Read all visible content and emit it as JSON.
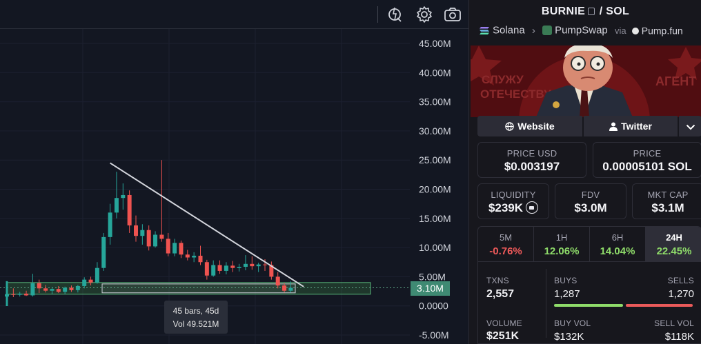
{
  "chart": {
    "y_axis_labels": [
      "45.00M",
      "40.00M",
      "35.00M",
      "30.00M",
      "25.00M",
      "20.00M",
      "15.00M",
      "10.00M",
      "5.00M",
      "0.0000",
      "-5.00M"
    ],
    "current_price_label": "3.10M",
    "range_tooltip": {
      "bars": "45 bars, 45d",
      "volume": "Vol 49.521M"
    },
    "up_color": "#26a69a",
    "down_color": "#ef5350",
    "price_tag_color": "#3f8a73"
  },
  "chart_data": {
    "type": "candlestick",
    "ylim": [
      -5000000,
      45000000
    ],
    "candles": [
      {
        "o": 1.6,
        "h": 2.2,
        "l": 1.2,
        "c": 2.0
      },
      {
        "o": 2.0,
        "h": 3.0,
        "l": 1.5,
        "c": 1.9
      },
      {
        "o": 1.9,
        "h": 2.4,
        "l": 1.6,
        "c": 2.1
      },
      {
        "o": 2.1,
        "h": 2.6,
        "l": 1.7,
        "c": 1.8
      },
      {
        "o": 1.8,
        "h": 5.5,
        "l": 1.6,
        "c": 3.9
      },
      {
        "o": 3.9,
        "h": 4.5,
        "l": 2.2,
        "c": 3.0
      },
      {
        "o": 3.0,
        "h": 3.6,
        "l": 2.3,
        "c": 2.6
      },
      {
        "o": 2.6,
        "h": 3.2,
        "l": 2.0,
        "c": 2.9
      },
      {
        "o": 2.9,
        "h": 3.4,
        "l": 2.2,
        "c": 2.4
      },
      {
        "o": 2.4,
        "h": 3.3,
        "l": 2.0,
        "c": 3.1
      },
      {
        "o": 3.1,
        "h": 3.5,
        "l": 2.4,
        "c": 2.7
      },
      {
        "o": 2.7,
        "h": 3.6,
        "l": 2.3,
        "c": 3.4
      },
      {
        "o": 3.4,
        "h": 4.9,
        "l": 3.0,
        "c": 4.5
      },
      {
        "o": 4.5,
        "h": 5.0,
        "l": 3.5,
        "c": 4.0
      },
      {
        "o": 4.0,
        "h": 7.5,
        "l": 3.8,
        "c": 6.5
      },
      {
        "o": 6.5,
        "h": 12.5,
        "l": 6.0,
        "c": 11.8
      },
      {
        "o": 11.8,
        "h": 17.5,
        "l": 10.5,
        "c": 16.0
      },
      {
        "o": 16.0,
        "h": 23.0,
        "l": 15.0,
        "c": 18.5
      },
      {
        "o": 18.5,
        "h": 21.0,
        "l": 16.5,
        "c": 19.0
      },
      {
        "o": 19.0,
        "h": 19.8,
        "l": 12.5,
        "c": 13.8
      },
      {
        "o": 13.8,
        "h": 15.5,
        "l": 11.0,
        "c": 12.0
      },
      {
        "o": 12.0,
        "h": 14.0,
        "l": 10.5,
        "c": 13.0
      },
      {
        "o": 13.0,
        "h": 13.8,
        "l": 9.5,
        "c": 10.2
      },
      {
        "o": 10.2,
        "h": 12.8,
        "l": 10.0,
        "c": 12.2
      },
      {
        "o": 12.2,
        "h": 25.0,
        "l": 11.0,
        "c": 11.5
      },
      {
        "o": 11.5,
        "h": 12.5,
        "l": 8.5,
        "c": 9.0
      },
      {
        "o": 9.0,
        "h": 11.5,
        "l": 8.5,
        "c": 10.8
      },
      {
        "o": 10.8,
        "h": 11.2,
        "l": 8.2,
        "c": 8.8
      },
      {
        "o": 8.8,
        "h": 9.6,
        "l": 7.8,
        "c": 8.3
      },
      {
        "o": 8.3,
        "h": 9.2,
        "l": 7.5,
        "c": 8.6
      },
      {
        "o": 8.6,
        "h": 10.3,
        "l": 7.0,
        "c": 7.5
      },
      {
        "o": 7.5,
        "h": 7.9,
        "l": 4.5,
        "c": 5.2
      },
      {
        "o": 5.2,
        "h": 7.8,
        "l": 5.0,
        "c": 7.0
      },
      {
        "o": 7.0,
        "h": 7.8,
        "l": 5.5,
        "c": 6.0
      },
      {
        "o": 6.0,
        "h": 7.5,
        "l": 5.4,
        "c": 6.9
      },
      {
        "o": 6.9,
        "h": 7.7,
        "l": 5.8,
        "c": 6.5
      },
      {
        "o": 6.5,
        "h": 7.2,
        "l": 5.9,
        "c": 6.7
      },
      {
        "o": 6.7,
        "h": 8.7,
        "l": 6.1,
        "c": 7.2
      },
      {
        "o": 7.2,
        "h": 8.5,
        "l": 6.2,
        "c": 6.8
      },
      {
        "o": 6.8,
        "h": 7.4,
        "l": 5.8,
        "c": 7.1
      },
      {
        "o": 7.1,
        "h": 8.0,
        "l": 6.0,
        "c": 7.0
      },
      {
        "o": 7.0,
        "h": 7.6,
        "l": 4.5,
        "c": 5.0
      },
      {
        "o": 5.0,
        "h": 5.8,
        "l": 3.0,
        "c": 3.5
      },
      {
        "o": 3.5,
        "h": 3.9,
        "l": 2.3,
        "c": 2.6
      },
      {
        "o": 2.6,
        "h": 4.2,
        "l": 2.3,
        "c": 3.1
      }
    ],
    "trendline": {
      "from": {
        "index": 16,
        "y": 24.5
      },
      "to": {
        "index": 46,
        "y": 3.3
      }
    },
    "range_y": [
      2.0,
      4.0
    ],
    "current_price": 3.1,
    "value_unit": "M"
  },
  "pair": {
    "base": "BURNIE",
    "sep": "/",
    "quote": "SOL",
    "chain": "Solana",
    "dex": "PumpSwap",
    "via_word": "via",
    "via": "Pump.fun"
  },
  "links": {
    "website": "Website",
    "twitter": "Twitter"
  },
  "stats": {
    "price_usd": {
      "label": "PRICE USD",
      "value": "$0.003197"
    },
    "price_native": {
      "label": "PRICE",
      "value": "0.00005101 SOL"
    },
    "liquidity": {
      "label": "LIQUIDITY",
      "value": "$239K"
    },
    "fdv": {
      "label": "FDV",
      "value": "$3.0M"
    },
    "mkt_cap": {
      "label": "MKT CAP",
      "value": "$3.1M"
    }
  },
  "timeframes": [
    {
      "label": "5M",
      "value": "-0.76%",
      "color": "#f05a5a"
    },
    {
      "label": "1H",
      "value": "12.06%",
      "color": "#8fdc6a"
    },
    {
      "label": "6H",
      "value": "14.04%",
      "color": "#8fdc6a"
    },
    {
      "label": "24H",
      "value": "22.45%",
      "color": "#8fdc6a"
    }
  ],
  "txns": {
    "txns_label": "TXNS",
    "txns_value": "2,557",
    "buys_label": "BUYS",
    "buys_value": "1,287",
    "sells_label": "SELLS",
    "sells_value": "1,270",
    "volume_label": "VOLUME",
    "volume_value": "$251K",
    "buy_vol_label": "BUY VOL",
    "buy_vol_value": "$132K",
    "sell_vol_label": "SELL VOL",
    "sell_vol_value": "$118K",
    "buy_color": "#8fdc6a",
    "sell_color": "#ea5a5a"
  }
}
